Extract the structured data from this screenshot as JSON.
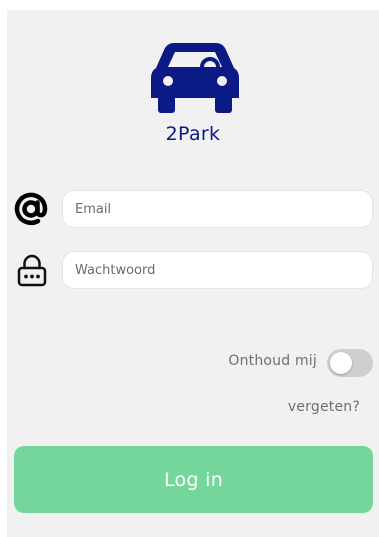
{
  "app": {
    "brand_name": "2Park",
    "brand_color": "#0c1a86",
    "logo_icon": "car-icon"
  },
  "login_form": {
    "email": {
      "icon": "at-sign-icon",
      "placeholder": "Email",
      "value": ""
    },
    "password": {
      "icon": "lock-icon",
      "placeholder": "Wachtwoord",
      "value": ""
    },
    "remember_me": {
      "label": "Onthoud mij",
      "enabled": false
    },
    "forgot_password_label": "vergeten?",
    "submit_label": "Log in",
    "submit_color": "#74d69a"
  }
}
